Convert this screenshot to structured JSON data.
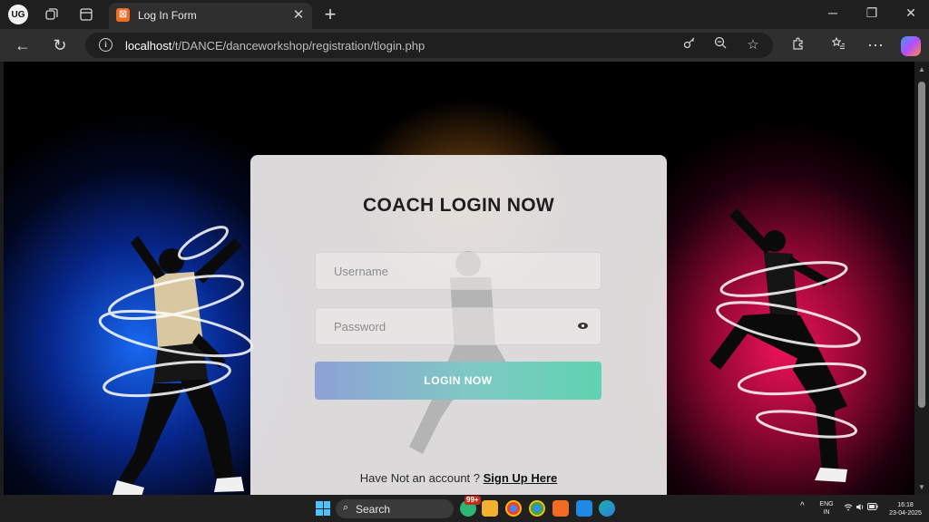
{
  "browser": {
    "profile_initials": "UG",
    "tab": {
      "title": "Log In Form",
      "favicon_letter": "☒"
    },
    "new_tab_glyph": "+",
    "window": {
      "minimize": "─",
      "restore": "❐",
      "close": "✕"
    },
    "nav": {
      "back": "←",
      "refresh": "↻"
    },
    "address": {
      "host": "localhost",
      "path": "/t/DANCE/danceworkshop/registration/tlogin.php"
    }
  },
  "page": {
    "form": {
      "title": "COACH LOGIN NOW",
      "username_placeholder": "Username",
      "password_placeholder": "Password",
      "submit_label": "LOGIN NOW",
      "signup_prompt": "Have Not an account ?",
      "signup_link": "Sign Up Here"
    },
    "colors": {
      "left_glow": "#1a6cff",
      "right_glow": "#ff1a5f",
      "button_gradient_start": "#8ea1d6",
      "button_gradient_end": "#5fd3b0"
    }
  },
  "taskbar": {
    "search_label": "Search",
    "notification_badge": "99+",
    "language": "ENG",
    "region": "IN",
    "time": "16:18",
    "date": "23-04-2025",
    "tray_chevron": "^"
  }
}
